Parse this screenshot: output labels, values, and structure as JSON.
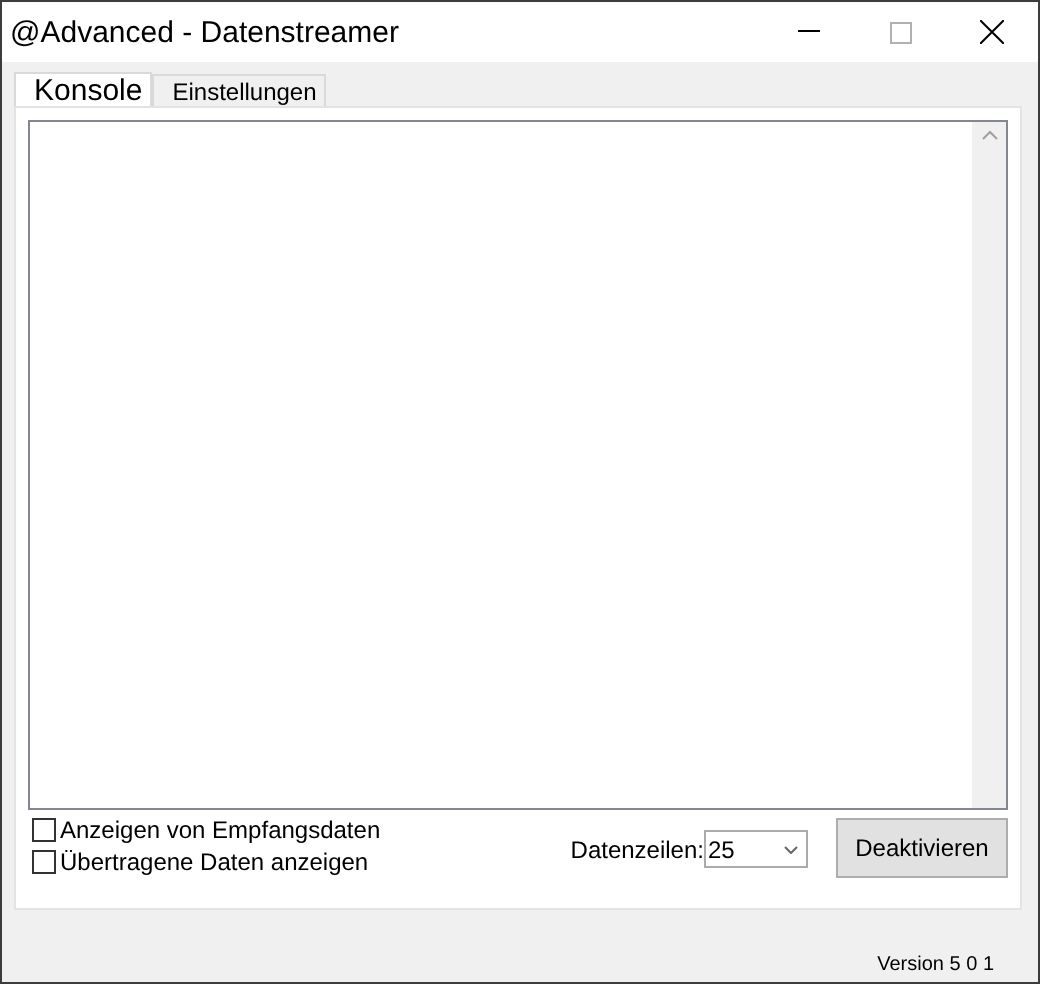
{
  "window": {
    "title": "@Advanced - Datenstreamer"
  },
  "tabs": [
    {
      "label": "Konsole",
      "selected": true
    },
    {
      "label": "Einstellungen",
      "selected": false
    }
  ],
  "options": [
    {
      "label": "Anzeigen von Empfangsdaten",
      "checked": false
    },
    {
      "label": "Übertragene Daten anzeigen",
      "checked": false
    }
  ],
  "data_lines": {
    "label": "Datenzeilen:",
    "value": "25"
  },
  "action_button": "Deaktivieren",
  "status_bar": {
    "version": "Version 5 0 1"
  }
}
